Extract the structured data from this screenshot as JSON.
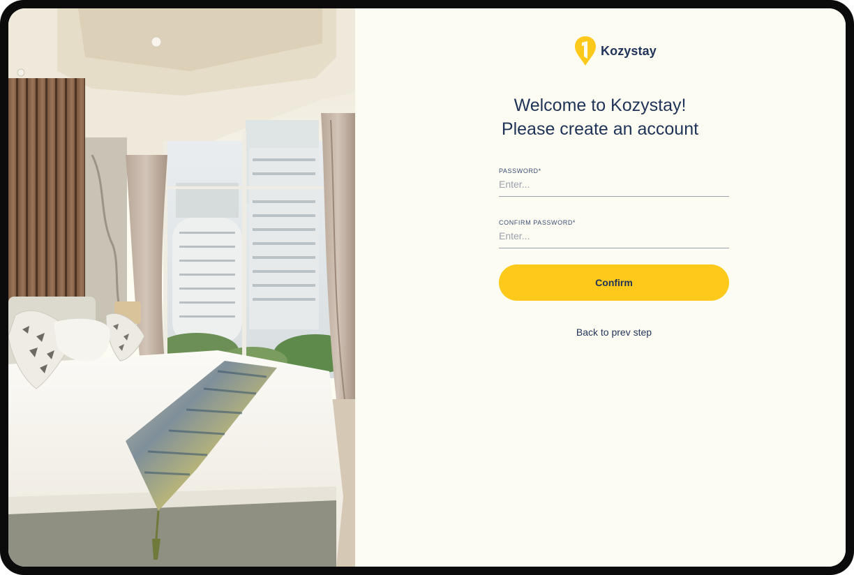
{
  "brand": {
    "name": "Kozystay",
    "accent_color": "#fec91b",
    "text_color": "#1f3358",
    "logo_icon": "kozystay-pin-logo-icon"
  },
  "photo": {
    "subject": "hotel-bedroom-photo"
  },
  "form": {
    "heading_line1": "Welcome to Kozystay!",
    "heading_line2": "Please create an account",
    "password": {
      "label": "PASSWORD*",
      "placeholder": "Enter...",
      "value": ""
    },
    "confirm_password": {
      "label": "CONFIRM PASSWORD*",
      "placeholder": "Enter...",
      "value": ""
    },
    "confirm_button_label": "Confirm",
    "back_link_label": "Back to prev step"
  }
}
